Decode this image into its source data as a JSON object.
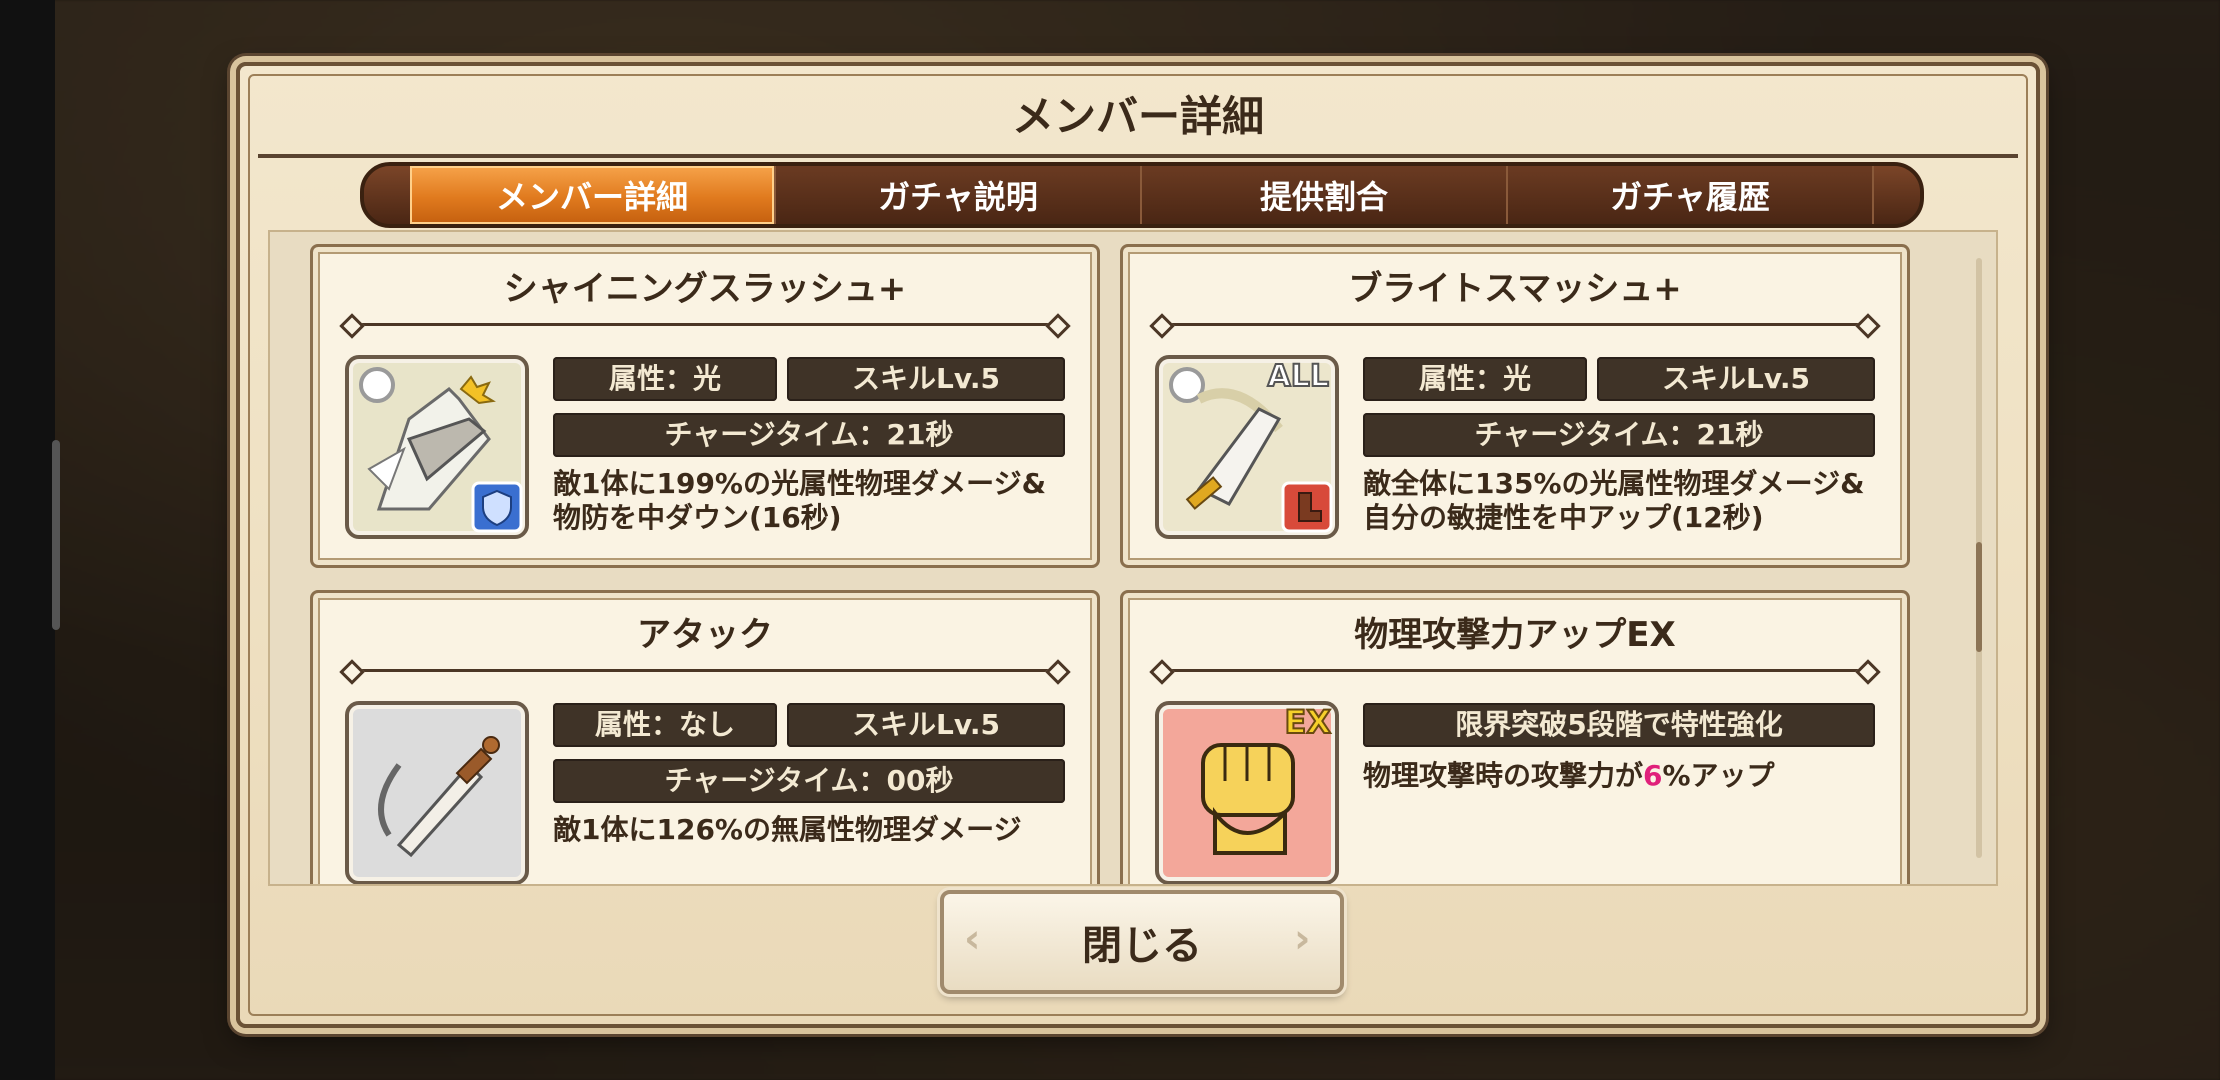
{
  "dialog": {
    "title": "メンバー詳細"
  },
  "tabs": [
    {
      "label": "メンバー詳細",
      "active": true
    },
    {
      "label": "ガチャ説明",
      "active": false
    },
    {
      "label": "提供割合",
      "active": false
    },
    {
      "label": "ガチャ履歴",
      "active": false
    }
  ],
  "skills": [
    {
      "title": "シャイニングスラッシュ+",
      "icon": "sword-slash-icon",
      "badge": "shield-badge",
      "attribute": "属性：光",
      "skill_level": "スキルLv.5",
      "charge_time": "チャージタイム：21秒",
      "description": "敵1体に199%の光属性物理ダメージ&物防を中ダウン(16秒)"
    },
    {
      "title": "ブライトスマッシュ+",
      "icon": "sword-smash-icon",
      "badge_text": "ALL",
      "badge": "boot-badge",
      "attribute": "属性：光",
      "skill_level": "スキルLv.5",
      "charge_time": "チャージタイム：21秒",
      "description": "敵全体に135%の光属性物理ダメージ&自分の敏捷性を中アップ(12秒)"
    },
    {
      "title": "アタック",
      "icon": "sword-attack-icon",
      "attribute": "属性：なし",
      "skill_level": "スキルLv.5",
      "charge_time": "チャージタイム：00秒",
      "description": "敵1体に126%の無属性物理ダメージ"
    },
    {
      "title": "物理攻撃力アップEX",
      "icon": "fist-icon",
      "badge_text": "EX",
      "condition": "限界突破5段階で特性強化",
      "description_pre": "物理攻撃時の攻撃力が",
      "description_value": "6",
      "description_post": "%アップ",
      "highlight_color": "#e0207a"
    }
  ],
  "close_button": {
    "label": "閉じる"
  }
}
